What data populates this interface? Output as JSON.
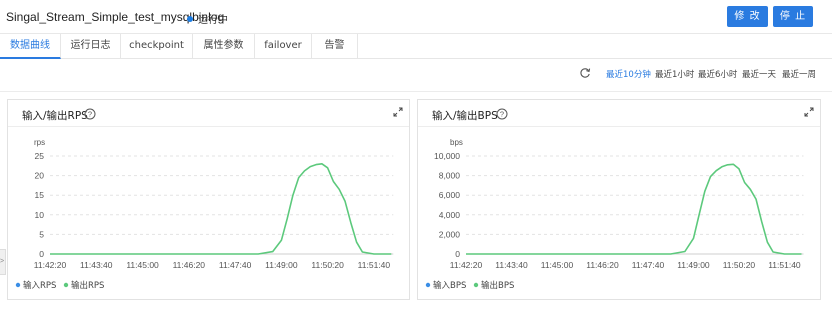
{
  "header": {
    "title": "Singal_Stream_Simple_test_mysqlbinlog",
    "status": "运行中",
    "status_color": "#1e7ee4",
    "edit_label": "修 改",
    "stop_label": "停 止",
    "accent": "#2a7be0"
  },
  "tabs": [
    {
      "label": "数据曲线",
      "active": true
    },
    {
      "label": "运行日志"
    },
    {
      "label": "checkpoint"
    },
    {
      "label": "属性参数"
    },
    {
      "label": "failover"
    },
    {
      "label": "告警"
    }
  ],
  "time_ranges": [
    {
      "label": "最近10分钟",
      "active": true
    },
    {
      "label": "最近1小时"
    },
    {
      "label": "最近6小时"
    },
    {
      "label": "最近一天"
    },
    {
      "label": "最近一周"
    }
  ],
  "icons": {
    "refresh": "refresh-icon",
    "help": "question-circle-icon",
    "expand": "expand-icon",
    "side": "chevron-right-icon"
  },
  "side_handle": ">",
  "chart_data": [
    {
      "type": "line",
      "title": "输入/输出RPS",
      "ylabel": "rps",
      "ylim": [
        0,
        25
      ],
      "yticks": [
        "0",
        "5",
        "10",
        "15",
        "20",
        "25"
      ],
      "xticks": [
        "11:42:20",
        "11:43:40",
        "11:45:00",
        "11:46:20",
        "11:47:40",
        "11:49:00",
        "11:50:20",
        "11:51:40"
      ],
      "grid": true,
      "legend_position": "bottom-left",
      "series": [
        {
          "name": "输入RPS",
          "color": "#3a8ee6",
          "points": []
        },
        {
          "name": "输出RPS",
          "color": "#5cc97c",
          "points": [
            [
              "11:42:20",
              0
            ],
            [
              "11:48:20",
              0
            ],
            [
              "11:48:45",
              0.6
            ],
            [
              "11:49:00",
              3.5
            ],
            [
              "11:49:10",
              9
            ],
            [
              "11:49:20",
              15
            ],
            [
              "11:49:30",
              19.5
            ],
            [
              "11:49:40",
              21.2
            ],
            [
              "11:49:50",
              22.3
            ],
            [
              "11:50:00",
              22.8
            ],
            [
              "11:50:10",
              23
            ],
            [
              "11:50:20",
              22
            ],
            [
              "11:50:30",
              18.5
            ],
            [
              "11:50:40",
              16.5
            ],
            [
              "11:50:50",
              13.5
            ],
            [
              "11:51:00",
              8
            ],
            [
              "11:51:10",
              3
            ],
            [
              "11:51:20",
              0.5
            ],
            [
              "11:51:40",
              0
            ],
            [
              "11:52:10",
              0
            ]
          ]
        }
      ]
    },
    {
      "type": "line",
      "title": "输入/输出BPS",
      "ylabel": "bps",
      "ylim": [
        0,
        10000
      ],
      "yticks": [
        "0",
        "2,000",
        "4,000",
        "6,000",
        "8,000",
        "10,000"
      ],
      "xticks": [
        "11:42:20",
        "11:43:40",
        "11:45:00",
        "11:46:20",
        "11:47:40",
        "11:49:00",
        "11:50:20",
        "11:51:40"
      ],
      "grid": true,
      "legend_position": "bottom-left",
      "series": [
        {
          "name": "输入BPS",
          "color": "#3a8ee6",
          "points": []
        },
        {
          "name": "输出BPS",
          "color": "#5cc97c",
          "points": [
            [
              "11:42:20",
              0
            ],
            [
              "11:48:20",
              0
            ],
            [
              "11:48:45",
              250
            ],
            [
              "11:49:00",
              1600
            ],
            [
              "11:49:10",
              4000
            ],
            [
              "11:49:20",
              6400
            ],
            [
              "11:49:30",
              7900
            ],
            [
              "11:49:40",
              8500
            ],
            [
              "11:49:50",
              8900
            ],
            [
              "11:50:00",
              9100
            ],
            [
              "11:50:10",
              9150
            ],
            [
              "11:50:20",
              8700
            ],
            [
              "11:50:30",
              7300
            ],
            [
              "11:50:40",
              6600
            ],
            [
              "11:50:50",
              5600
            ],
            [
              "11:51:00",
              3300
            ],
            [
              "11:51:10",
              1200
            ],
            [
              "11:51:20",
              200
            ],
            [
              "11:51:40",
              0
            ],
            [
              "11:52:10",
              0
            ]
          ]
        }
      ]
    }
  ]
}
